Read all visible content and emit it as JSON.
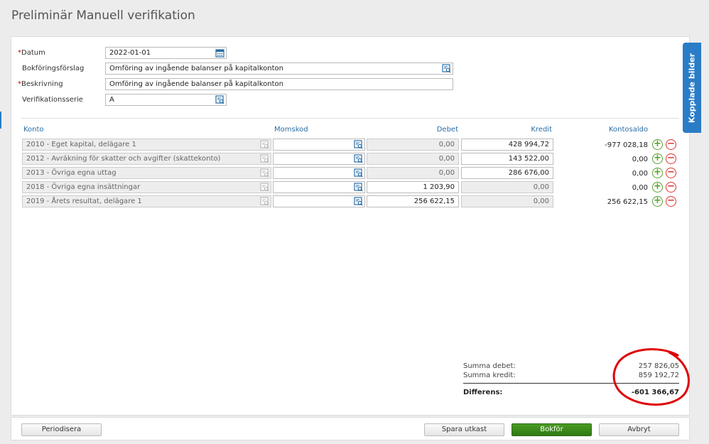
{
  "title": "Preliminär Manuell verifikation",
  "form": {
    "datum": {
      "label": "Datum",
      "required": true,
      "value": "2022-01-01"
    },
    "bokforingsforslag": {
      "label": "Bokföringsförslag",
      "value": "Omföring av ingående balanser på kapitalkonton"
    },
    "beskrivning": {
      "label": "Beskrivning",
      "required": true,
      "value": "Omföring av ingående balanser på kapitalkonton"
    },
    "verifikationsserie": {
      "label": "Verifikationsserie",
      "value": "A"
    }
  },
  "table": {
    "headers": {
      "konto": "Konto",
      "momskod": "Momskod",
      "debet": "Debet",
      "kredit": "Kredit",
      "kontosaldo": "Kontosaldo"
    },
    "rows": [
      {
        "konto": "2010 - Eget kapital, delägare 1",
        "momskod": "",
        "debet": "0,00",
        "kredit": "428 994,72",
        "saldo": "-977 028,18"
      },
      {
        "konto": "2012 - Avräkning för skatter och avgifter (skattekonto)",
        "momskod": "",
        "debet": "0,00",
        "kredit": "143 522,00",
        "saldo": "0,00"
      },
      {
        "konto": "2013 - Övriga egna uttag",
        "momskod": "",
        "debet": "0,00",
        "kredit": "286 676,00",
        "saldo": "0,00"
      },
      {
        "konto": "2018 - Övriga egna insättningar",
        "momskod": "",
        "debet": "1 203,90",
        "kredit": "0,00",
        "saldo": "0,00"
      },
      {
        "konto": "2019 - Årets resultat, delägare 1",
        "momskod": "",
        "debet": "256 622,15",
        "kredit": "0,00",
        "saldo": "256 622,15"
      }
    ]
  },
  "summary": {
    "summa_debet_label": "Summa debet:",
    "summa_debet": "257 826,05",
    "summa_kredit_label": "Summa kredit:",
    "summa_kredit": "859 192,72",
    "differens_label": "Differens:",
    "differens": "-601 366,67"
  },
  "buttons": {
    "periodisera": "Periodisera",
    "spara_utkast": "Spara utkast",
    "bokfor": "Bokför",
    "avbryt": "Avbryt"
  },
  "side_tab": "Kopplade bilder",
  "icons": {
    "calendar": "calendar-icon",
    "lookup": "lookup-icon",
    "add": "plus-circle-icon",
    "remove": "minus-circle-icon"
  },
  "colors": {
    "link_blue": "#2a6ea8",
    "primary_green": "#3a8a1c",
    "annotation_red": "#e00000"
  }
}
